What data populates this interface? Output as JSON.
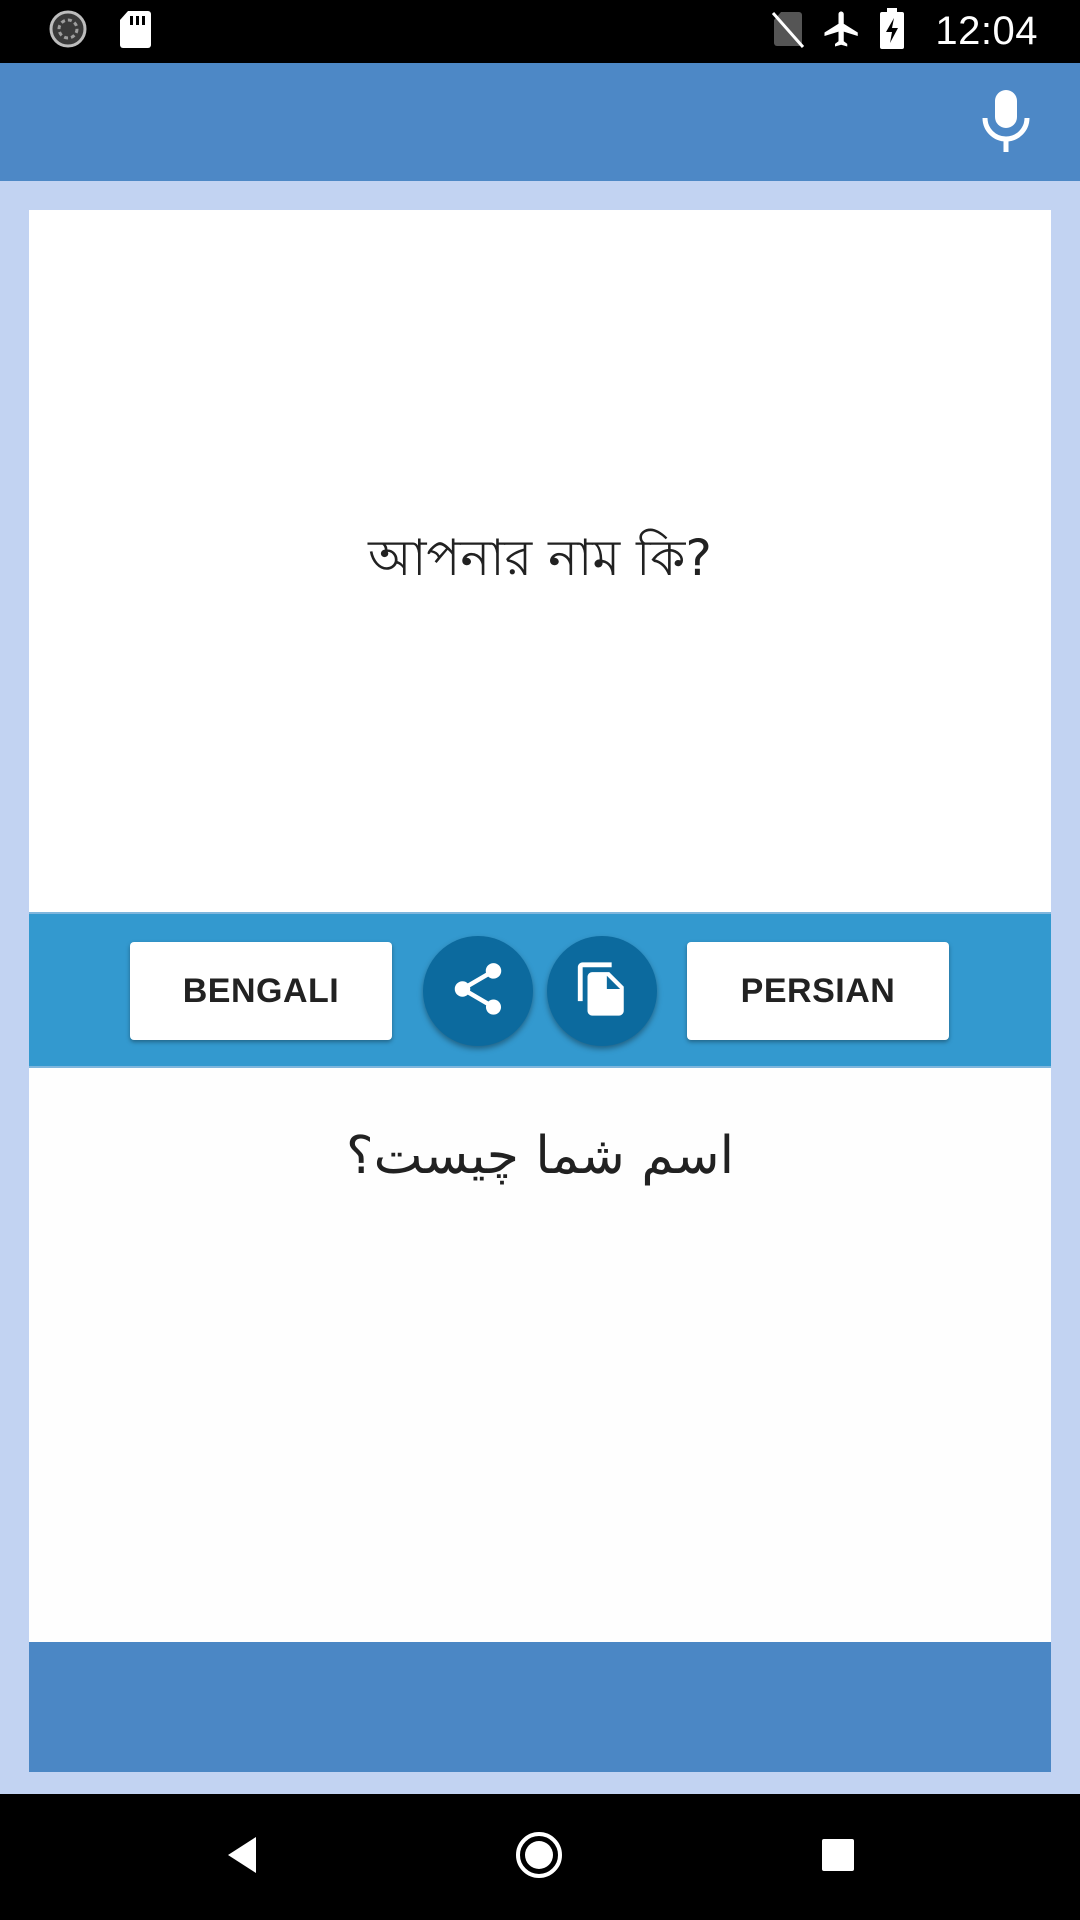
{
  "status_bar": {
    "time": "12:04",
    "icons": [
      "sync-icon",
      "sd-card-icon",
      "no-sim-icon",
      "airplane-mode-icon",
      "battery-charging-icon"
    ]
  },
  "app_bar": {
    "mic_icon": "microphone-icon"
  },
  "source_panel": {
    "text": "আপনার নাম কি?"
  },
  "toolbar": {
    "source_language": "BENGALI",
    "target_language": "PERSIAN",
    "share_icon": "share-icon",
    "copy_icon": "copy-icon"
  },
  "target_panel": {
    "text": "اسم شما چیست؟"
  },
  "nav_bar": {
    "icons": [
      "back-icon",
      "home-icon",
      "recents-icon"
    ]
  },
  "colors": {
    "app_bar": "#4d88c6",
    "background": "#c2d3f2",
    "toolbar": "#3399cf",
    "round_button": "#0c6a9e",
    "ad_bar": "#4b87c5"
  }
}
